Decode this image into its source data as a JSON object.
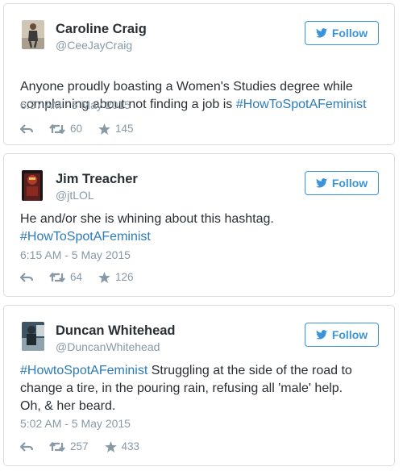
{
  "tweets": [
    {
      "name": "Caroline Craig",
      "handle": "@CeeJayCraig",
      "follow_label": "Follow",
      "text_before": "Anyone proudly boasting a Women's Studies degree while complaining about not finding a job is ",
      "hashtag": "#HowToSpotAFeminist",
      "text_after": "",
      "timestamp": "6:37 AM - 5 May 2015",
      "retweets": "60",
      "favorites": "145"
    },
    {
      "name": "Jim Treacher",
      "handle": "@jtLOL",
      "follow_label": "Follow",
      "text_before": "He and/or she is whining about this hashtag. ",
      "hashtag": "#HowToSpotAFeminist",
      "text_after": "",
      "timestamp": "6:15 AM - 5 May 2015",
      "retweets": "64",
      "favorites": "126"
    },
    {
      "name": "Duncan Whitehead",
      "handle": "@DuncanWhitehead",
      "follow_label": "Follow",
      "text_before": "",
      "hashtag": "#HowtoSpotAFeminist",
      "text_after": " Struggling at the side of the road to change a tire, in the pouring rain, refusing all 'male' help. Oh, & her beard.",
      "timestamp": "5:02 AM - 5 May 2015",
      "retweets": "257",
      "favorites": "433"
    }
  ],
  "colors": {
    "link": "#2b7bb9",
    "follow": "#3b94d9",
    "muted": "#8899a6"
  },
  "icons": [
    "reply-icon",
    "retweet-icon",
    "star-icon",
    "bird-icon"
  ]
}
